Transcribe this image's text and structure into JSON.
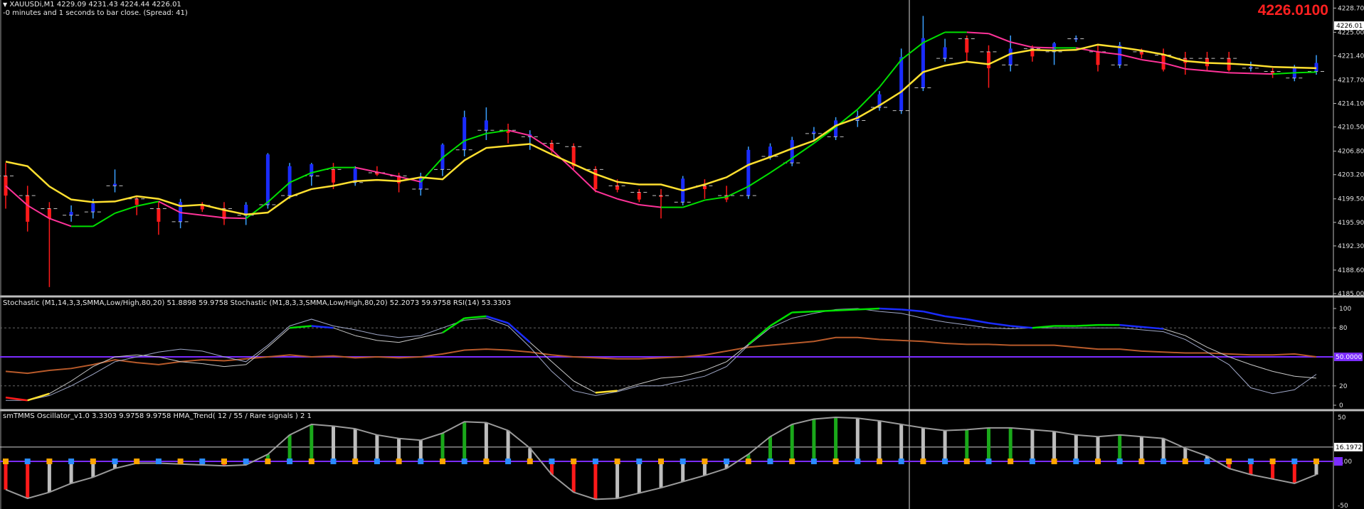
{
  "header": {
    "symbol_line": "XAUUSDi,M1  4229.09 4231.43 4224.44 4226.01",
    "countdown": "-0 minutes and 1 seconds to bar close. (Spread: 41)",
    "big_price": "4226.0100"
  },
  "colors": {
    "background": "#000000",
    "bull": "#1a2cff",
    "bull_wick": "#3aa0ff",
    "bear": "#ff1a1a",
    "ha_up": "#00e000",
    "ha_dn": "#ff3399",
    "ma_slow": "#ffe030",
    "big_price": "#ff2020",
    "level_line": "#7b2cff"
  },
  "panels": {
    "price": {
      "axis_ticks": [
        "4228.70",
        "4225.00",
        "4221.40",
        "4217.70",
        "4214.10",
        "4210.50",
        "4206.80",
        "4203.20",
        "4199.50",
        "4195.90",
        "4192.30",
        "4188.60",
        "4185.00"
      ],
      "current_label": "4226.01"
    },
    "stoch": {
      "label": "Stochastic (M1,14,3,3,SMMA,Low/High,80,20) 51.8898 59.9758  Stochastic (M1,8,3,3,SMMA,Low/High,80,20) 52.2073 59.9758  RSI(14) 53.3303",
      "axis_ticks": [
        "100",
        "80",
        "20",
        "0"
      ],
      "level_label": "50.0000"
    },
    "osc": {
      "label": "smTMMS Oscillator_v1.0 3.3303 9.9758 9.9758  HMA_Trend( 12 / 55 / Rare signals ) 2 1",
      "axis_ticks": [
        "50",
        "0.00",
        "-50"
      ],
      "level_label": "16.1972",
      "zero_label": "0.00"
    }
  },
  "chart_data": [
    {
      "type": "candlestick",
      "title": "XAUUSDi,M1",
      "ylim": [
        4185.0,
        4229.5
      ],
      "ohlc": [
        [
          4203.0,
          4205.0,
          4198.0,
          4200.0
        ],
        [
          4200.0,
          4201.5,
          4194.5,
          4196.0
        ],
        [
          4198.0,
          4199.0,
          4186.0,
          4196.5
        ],
        [
          4197.0,
          4198.5,
          4196.0,
          4197.5
        ],
        [
          4197.5,
          4199.5,
          4196.5,
          4198.8
        ],
        [
          4201.5,
          4204.0,
          4200.5,
          4201.8
        ],
        [
          4199.5,
          4200.0,
          4197.0,
          4198.6
        ],
        [
          4198.0,
          4199.0,
          4194.0,
          4196.0
        ],
        [
          4196.0,
          4199.5,
          4195.0,
          4199.0
        ],
        [
          4198.5,
          4199.0,
          4197.5,
          4197.9
        ],
        [
          4198.0,
          4199.0,
          4195.5,
          4196.4
        ],
        [
          4197.0,
          4199.0,
          4195.5,
          4198.6
        ],
        [
          4198.6,
          4206.5,
          4198.0,
          4206.3
        ],
        [
          4200.0,
          4205.0,
          4199.5,
          4204.5
        ],
        [
          4203.0,
          4205.0,
          4201.5,
          4204.8
        ],
        [
          4204.0,
          4205.0,
          4201.0,
          4202.0
        ],
        [
          4202.0,
          4204.5,
          4201.5,
          4204.1
        ],
        [
          4203.5,
          4204.5,
          4203.0,
          4203.2
        ],
        [
          4203.0,
          4203.5,
          4200.5,
          4201.9
        ],
        [
          4201.0,
          4203.5,
          4200.0,
          4202.7
        ],
        [
          4204.0,
          4208.0,
          4203.0,
          4207.8
        ],
        [
          4207.0,
          4213.0,
          4206.0,
          4212.0
        ],
        [
          4210.0,
          4213.5,
          4208.5,
          4211.5
        ],
        [
          4210.0,
          4211.0,
          4208.0,
          4209.6
        ],
        [
          4209.0,
          4210.0,
          4207.0,
          4209.4
        ],
        [
          4208.0,
          4208.5,
          4206.5,
          4206.9
        ],
        [
          4207.5,
          4208.0,
          4204.0,
          4204.5
        ],
        [
          4204.0,
          4204.5,
          4200.5,
          4201.0
        ],
        [
          4201.5,
          4202.5,
          4200.5,
          4200.9
        ],
        [
          4200.5,
          4201.0,
          4199.0,
          4199.4
        ],
        [
          4200.0,
          4201.0,
          4196.5,
          4199.9
        ],
        [
          4199.0,
          4203.0,
          4198.5,
          4202.6
        ],
        [
          4201.5,
          4202.5,
          4199.5,
          4201.0
        ],
        [
          4200.0,
          4201.5,
          4199.0,
          4199.4
        ],
        [
          4200.0,
          4207.5,
          4199.5,
          4207.0
        ],
        [
          4206.0,
          4208.0,
          4205.5,
          4207.5
        ],
        [
          4205.0,
          4209.0,
          4204.5,
          4208.5
        ],
        [
          4209.5,
          4210.5,
          4208.5,
          4209.8
        ],
        [
          4209.0,
          4212.0,
          4208.5,
          4211.5
        ],
        [
          4211.5,
          4213.0,
          4210.5,
          4212.2
        ],
        [
          4213.5,
          4216.0,
          4213.0,
          4215.5
        ],
        [
          4213.0,
          4222.5,
          4212.5,
          4221.2
        ],
        [
          4216.5,
          4227.5,
          4216.0,
          4224.1
        ],
        [
          4221.0,
          4224.0,
          4220.5,
          4222.7
        ],
        [
          4224.0,
          4224.5,
          4220.5,
          4221.9
        ],
        [
          4222.0,
          4223.0,
          4216.5,
          4219.5
        ],
        [
          4220.0,
          4224.5,
          4219.0,
          4222.5
        ],
        [
          4222.5,
          4223.0,
          4220.5,
          4221.3
        ],
        [
          4222.0,
          4223.5,
          4220.0,
          4223.3
        ],
        [
          4224.0,
          4224.5,
          4223.5,
          4224.1
        ],
        [
          4222.0,
          4223.0,
          4219.0,
          4220.0
        ],
        [
          4220.0,
          4223.5,
          4219.5,
          4223.0
        ],
        [
          4222.0,
          4222.5,
          4221.0,
          4221.6
        ],
        [
          4221.5,
          4222.5,
          4219.0,
          4219.3
        ],
        [
          4221.0,
          4222.0,
          4218.5,
          4220.3
        ],
        [
          4221.0,
          4222.0,
          4219.0,
          4219.8
        ],
        [
          4221.0,
          4222.0,
          4219.0,
          4219.2
        ],
        [
          4219.5,
          4220.5,
          4219.0,
          4219.7
        ],
        [
          4219.0,
          4219.5,
          4218.0,
          4218.6
        ],
        [
          4218.0,
          4220.0,
          4217.5,
          4219.7
        ],
        [
          4219.0,
          4221.5,
          4218.5,
          4220.3
        ]
      ],
      "ma_fast_ha": [
        4201.5,
        4198.5,
        4196.5,
        4195.3,
        4195.3,
        4197.3,
        4198.4,
        4199.1,
        4197.4,
        4197.0,
        4196.6,
        4196.5,
        4199.0,
        4202.0,
        4203.5,
        4204.3,
        4204.3,
        4203.6,
        4202.9,
        4202.1,
        4205.8,
        4208.4,
        4209.5,
        4210.0,
        4209.2,
        4207.0,
        4203.9,
        4200.7,
        4199.5,
        4198.6,
        4198.2,
        4198.2,
        4199.3,
        4199.8,
        4201.4,
        4203.5,
        4205.7,
        4208.0,
        4210.5,
        4213.2,
        4216.6,
        4220.8,
        4223.4,
        4225.0,
        4225.0,
        4224.8,
        4223.5,
        4222.7,
        4222.6,
        4222.6,
        4222.0,
        4221.6,
        4220.8,
        4220.3,
        4219.4,
        4219.1,
        4218.8,
        4218.7,
        4218.6,
        4218.8,
        4218.9
      ],
      "ma_slow": [
        4205.2,
        4204.5,
        4201.4,
        4199.4,
        4199.0,
        4199.1,
        4199.9,
        4199.5,
        4198.4,
        4198.6,
        4197.8,
        4197.1,
        4197.4,
        4199.8,
        4201.0,
        4201.5,
        4202.2,
        4202.4,
        4202.2,
        4202.8,
        4202.5,
        4205.4,
        4207.3,
        4207.6,
        4207.9,
        4206.3,
        4204.8,
        4203.3,
        4202.1,
        4201.7,
        4201.7,
        4200.8,
        4201.7,
        4202.8,
        4204.7,
        4205.9,
        4207.2,
        4208.4,
        4210.7,
        4211.9,
        4213.8,
        4215.9,
        4218.9,
        4219.9,
        4220.5,
        4220.1,
        4221.7,
        4222.3,
        4222.2,
        4222.3,
        4223.1,
        4222.7,
        4222.2,
        4221.6,
        4220.6,
        4220.3,
        4220.2,
        4220.0,
        4219.7,
        4219.6,
        4219.5
      ]
    },
    {
      "type": "line",
      "title": "Stochastic / RSI",
      "ylim": [
        0,
        100
      ],
      "series": [
        {
          "name": "Stochastic (M1,14,3,3,SMMA,Low/High,80,20)",
          "values": [
            8,
            5,
            12,
            25,
            40,
            50,
            52,
            50,
            45,
            43,
            40,
            42,
            60,
            80,
            82,
            80,
            72,
            67,
            65,
            70,
            75,
            90,
            92,
            85,
            65,
            45,
            25,
            13,
            15,
            22,
            28,
            30,
            36,
            45,
            63,
            82,
            96,
            97,
            98,
            99,
            100,
            99,
            97,
            92,
            89,
            85,
            82,
            80,
            82,
            82,
            83,
            83,
            81,
            79,
            72,
            60,
            50,
            42,
            35,
            30,
            28
          ]
        },
        {
          "name": "Stochastic (M1,8,3,3,SMMA,Low/High,80,20)",
          "values": [
            5,
            5,
            10,
            20,
            32,
            45,
            50,
            55,
            58,
            56,
            50,
            45,
            62,
            82,
            89,
            82,
            78,
            73,
            70,
            72,
            80,
            88,
            90,
            82,
            60,
            35,
            15,
            10,
            14,
            20,
            20,
            25,
            30,
            40,
            62,
            80,
            90,
            95,
            99,
            100,
            97,
            95,
            90,
            86,
            83,
            80,
            79,
            80,
            80,
            80,
            80,
            80,
            78,
            76,
            68,
            55,
            42,
            18,
            12,
            16,
            32
          ]
        },
        {
          "name": "RSI(14)",
          "values": [
            35,
            33,
            36,
            38,
            42,
            47,
            44,
            42,
            45,
            47,
            46,
            48,
            50,
            52,
            50,
            51,
            49,
            50,
            49,
            50,
            53,
            57,
            58,
            57,
            55,
            52,
            50,
            49,
            48,
            48,
            49,
            50,
            52,
            56,
            60,
            62,
            64,
            66,
            70,
            70,
            68,
            67,
            66,
            64,
            63,
            63,
            62,
            62,
            62,
            60,
            58,
            58,
            56,
            55,
            54,
            54,
            53,
            52,
            52,
            53,
            50
          ]
        }
      ]
    },
    {
      "type": "bar",
      "title": "smTMMS Oscillator_v1.0",
      "ylim": [
        -50,
        50
      ],
      "values": [
        -32,
        -42,
        -35,
        -25,
        -18,
        -8,
        -2,
        -2,
        -3,
        -4,
        -5,
        -4,
        8,
        30,
        42,
        40,
        37,
        30,
        26,
        24,
        32,
        45,
        44,
        35,
        15,
        -15,
        -35,
        -43,
        -42,
        -36,
        -30,
        -23,
        -16,
        -8,
        8,
        28,
        42,
        48,
        50,
        49,
        46,
        42,
        38,
        35,
        36,
        38,
        38,
        36,
        34,
        30,
        28,
        30,
        28,
        26,
        15,
        6,
        -8,
        -15,
        -20,
        -25,
        -15
      ]
    }
  ]
}
